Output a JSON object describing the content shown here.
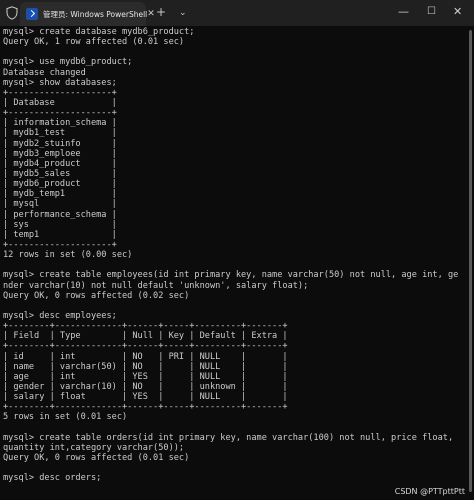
{
  "window": {
    "tab_title": "管理员: Windows PowerShell",
    "tab_close": "✕",
    "new_tab": "+",
    "tab_dropdown": "⌄",
    "minimize": "—",
    "maximize": "☐",
    "close": "✕",
    "icons": {
      "shield": "shield-icon",
      "powershell": "powershell-icon"
    }
  },
  "terminal": {
    "lines": [
      "mysql> create database mydb6_product;",
      "Query OK, 1 row affected (0.01 sec)",
      "",
      "mysql> use mydb6_product;",
      "Database changed",
      "mysql> show databases;",
      "+--------------------+",
      "| Database           |",
      "+--------------------+",
      "| information_schema |",
      "| mydb1_test         |",
      "| mydb2_stuinfo      |",
      "| mydb3_emploee      |",
      "| mydb4_product      |",
      "| mydb5_sales        |",
      "| mydb6_product      |",
      "| mydb_temp1         |",
      "| mysql              |",
      "| performance_schema |",
      "| sys                |",
      "| temp1              |",
      "+--------------------+",
      "12 rows in set (0.00 sec)",
      "",
      "mysql> create table employees(id int primary key, name varchar(50) not null, age int, ge",
      "nder varchar(10) not null default 'unknown', salary float);",
      "Query OK, 0 rows affected (0.02 sec)",
      "",
      "mysql> desc employees;",
      "+--------+-------------+------+-----+---------+-------+",
      "| Field  | Type        | Null | Key | Default | Extra |",
      "+--------+-------------+------+-----+---------+-------+",
      "| id     | int         | NO   | PRI | NULL    |       |",
      "| name   | varchar(50) | NO   |     | NULL    |       |",
      "| age    | int         | YES  |     | NULL    |       |",
      "| gender | varchar(10) | NO   |     | unknown |       |",
      "| salary | float       | YES  |     | NULL    |       |",
      "+--------+-------------+------+-----+---------+-------+",
      "5 rows in set (0.01 sec)",
      "",
      "mysql> create table orders(id int primary key, name varchar(100) not null, price float,",
      "quantity int,category varchar(50));",
      "Query OK, 0 rows affected (0.01 sec)",
      "",
      "mysql> desc orders;"
    ]
  },
  "watermark": "CSDN @PTTpttPtt",
  "colors": {
    "terminal_bg": "#0c0c0c",
    "titlebar_bg": "#202020",
    "tab_bg": "#2b2b2b",
    "text": "#cccccc",
    "powershell_icon": "#1b4fa8"
  }
}
